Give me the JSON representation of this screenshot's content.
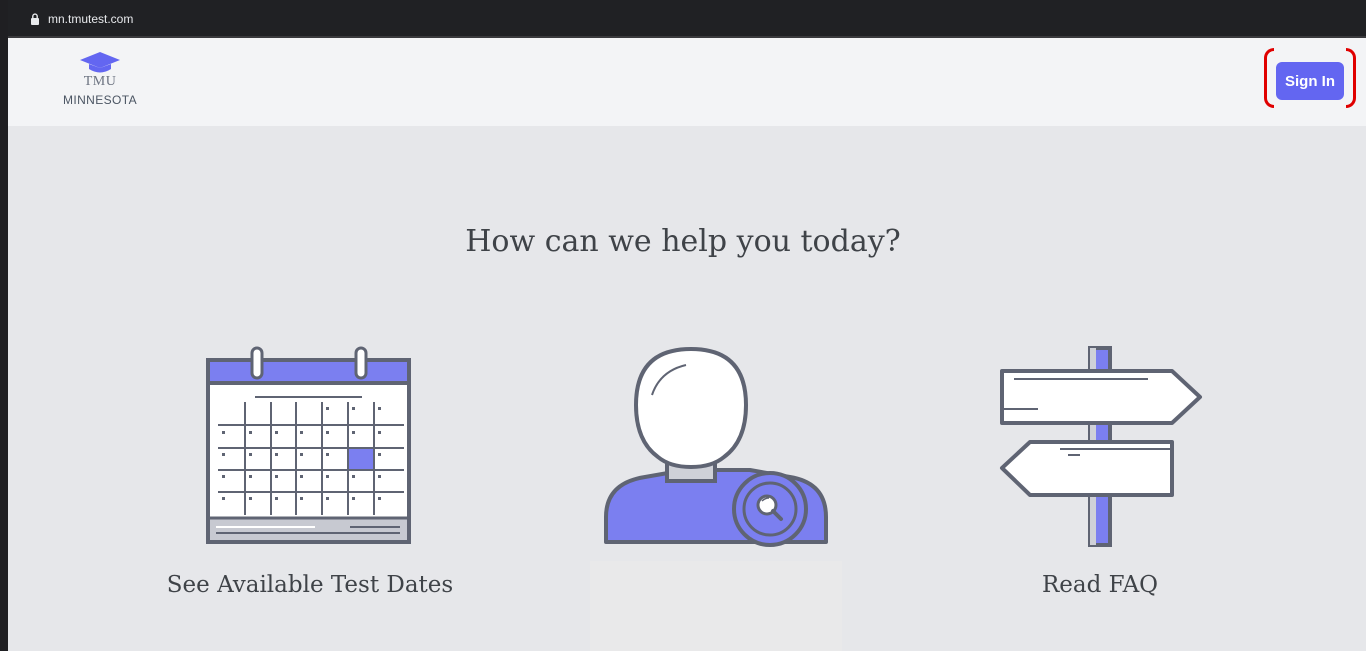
{
  "browser": {
    "url": "mn.tmutest.com"
  },
  "header": {
    "logo": {
      "line1": "TMU",
      "line2": "MINNESOTA"
    },
    "sign_in_label": "Sign In"
  },
  "main": {
    "title": "How can we help you today?",
    "cards": [
      {
        "id": "test-dates",
        "label": "See Available Test Dates",
        "icon": "calendar-icon"
      },
      {
        "id": "profile-search",
        "label": "",
        "icon": "user-search-icon"
      },
      {
        "id": "faq",
        "label": "Read FAQ",
        "icon": "signpost-icon"
      }
    ]
  },
  "colors": {
    "accent": "#6366f1",
    "page_bg": "#e6e7ea",
    "header_bg": "#f3f4f6",
    "illustration_stroke": "#5f6473",
    "highlight_bracket": "#e00000"
  }
}
